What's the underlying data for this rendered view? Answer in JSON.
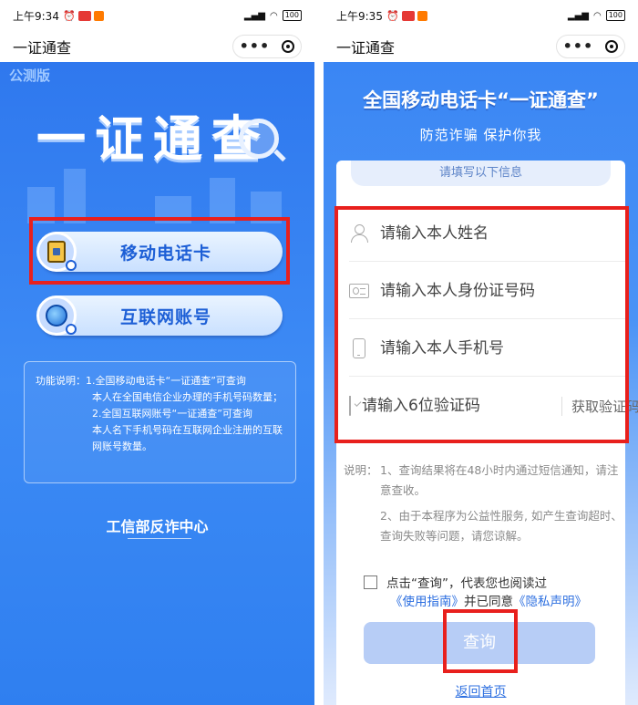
{
  "left": {
    "status": {
      "time": "上午9:34",
      "battery": "100"
    },
    "title": "一证通查",
    "beta_tag": "公测版",
    "hero_title": "一证通查",
    "buttons": [
      {
        "label": "移动电话卡",
        "icon": "sim-card-icon"
      },
      {
        "label": "互联网账号",
        "icon": "globe-icon"
      }
    ],
    "description": {
      "label": "功能说明：",
      "item1_head": "1.全国移动电话卡“一证通查”可查询",
      "item1_tail": "本人在全国电信企业办理的手机号码数量；",
      "item2_head": "2.全国互联网账号“一证通查”可查询",
      "item2_tail": "本人名下手机号码在互联网企业注册的互联网账号数量。"
    },
    "footer": "工信部反诈中心"
  },
  "right": {
    "status": {
      "time": "上午9:35",
      "battery": "100"
    },
    "title": "一证通查",
    "banner_title": "全国移动电话卡“一证通查”",
    "banner_subtitle": "防范诈骗 保护你我",
    "form_tab": "请填写以下信息",
    "fields": [
      {
        "placeholder": "请输入本人姓名",
        "icon": "user-icon"
      },
      {
        "placeholder": "请输入本人身份证号码",
        "icon": "id-card-icon"
      },
      {
        "placeholder": "请输入本人手机号",
        "icon": "phone-icon"
      },
      {
        "placeholder": "请输入6位验证码",
        "icon": "shield-icon"
      }
    ],
    "get_code": "获取验证码",
    "notes": {
      "label": "说明：",
      "note1": "1、查询结果将在48小时内通过短信通知，请注意查收。",
      "note2": "2、由于本程序为公益性服务, 如产生查询超时、查询失败等问题，请您谅解。"
    },
    "agreement": {
      "prefix": "点击“查询”，代表您也阅读过",
      "guide_link": "《使用指南》",
      "middle": "并已同意",
      "privacy_link": "《隐私声明》"
    },
    "query_button": "查询",
    "back_home": "返回首页"
  },
  "colors": {
    "highlight": "#e8201d",
    "primary_blue": "#2f78ee",
    "link_blue": "#2d6fe0"
  }
}
